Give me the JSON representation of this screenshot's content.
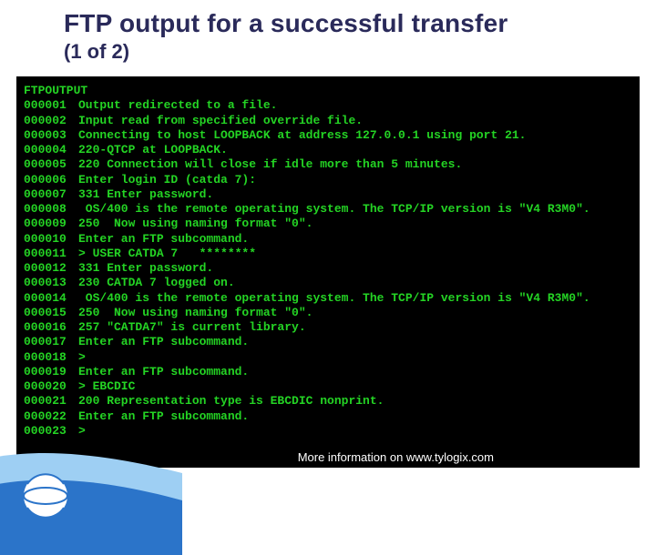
{
  "title": {
    "main": "FTP output for a successful transfer",
    "sub": "(1 of 2)"
  },
  "terminal": {
    "header": "FTPOUTPUT",
    "lines": [
      {
        "n": "000001",
        "t": "Output redirected to a file."
      },
      {
        "n": "000002",
        "t": "Input read from specified override file."
      },
      {
        "n": "000003",
        "t": "Connecting to host LOOPBACK at address 127.0.0.1 using port 21."
      },
      {
        "n": "000004",
        "t": "220-QTCP at LOOPBACK."
      },
      {
        "n": "000005",
        "t": "220 Connection will close if idle more than 5 minutes."
      },
      {
        "n": "000006",
        "t": "Enter login ID (catda 7):"
      },
      {
        "n": "000007",
        "t": "331 Enter password."
      },
      {
        "n": "000008",
        "t": " OS/400 is the remote operating system. The TCP/IP version is \"V4 R3M0\"."
      },
      {
        "n": "000009",
        "t": "250  Now using naming format \"0\"."
      },
      {
        "n": "000010",
        "t": "Enter an FTP subcommand."
      },
      {
        "n": "000011",
        "t": "> USER CATDA 7   ********"
      },
      {
        "n": "000012",
        "t": "331 Enter password."
      },
      {
        "n": "000013",
        "t": "230 CATDA 7 logged on."
      },
      {
        "n": "000014",
        "t": " OS/400 is the remote operating system. The TCP/IP version is \"V4 R3M0\"."
      },
      {
        "n": "000015",
        "t": "250  Now using naming format \"0\"."
      },
      {
        "n": "000016",
        "t": "257 \"CATDA7\" is current library."
      },
      {
        "n": "000017",
        "t": "Enter an FTP subcommand."
      },
      {
        "n": "000018",
        "t": ">"
      },
      {
        "n": "000019",
        "t": "Enter an FTP subcommand."
      },
      {
        "n": "000020",
        "t": "> EBCDIC"
      },
      {
        "n": "000021",
        "t": "200 Representation type is EBCDIC nonprint."
      },
      {
        "n": "000022",
        "t": "Enter an FTP subcommand."
      },
      {
        "n": "000023",
        "t": ">"
      }
    ]
  },
  "footer": {
    "more_info": "More information on www.tylogix.com"
  },
  "colors": {
    "title": "#2a2a5a",
    "terminal_bg": "#000000",
    "terminal_fg": "#24d424",
    "swoosh_a": "#9ecff3",
    "swoosh_b": "#2b74c9"
  }
}
